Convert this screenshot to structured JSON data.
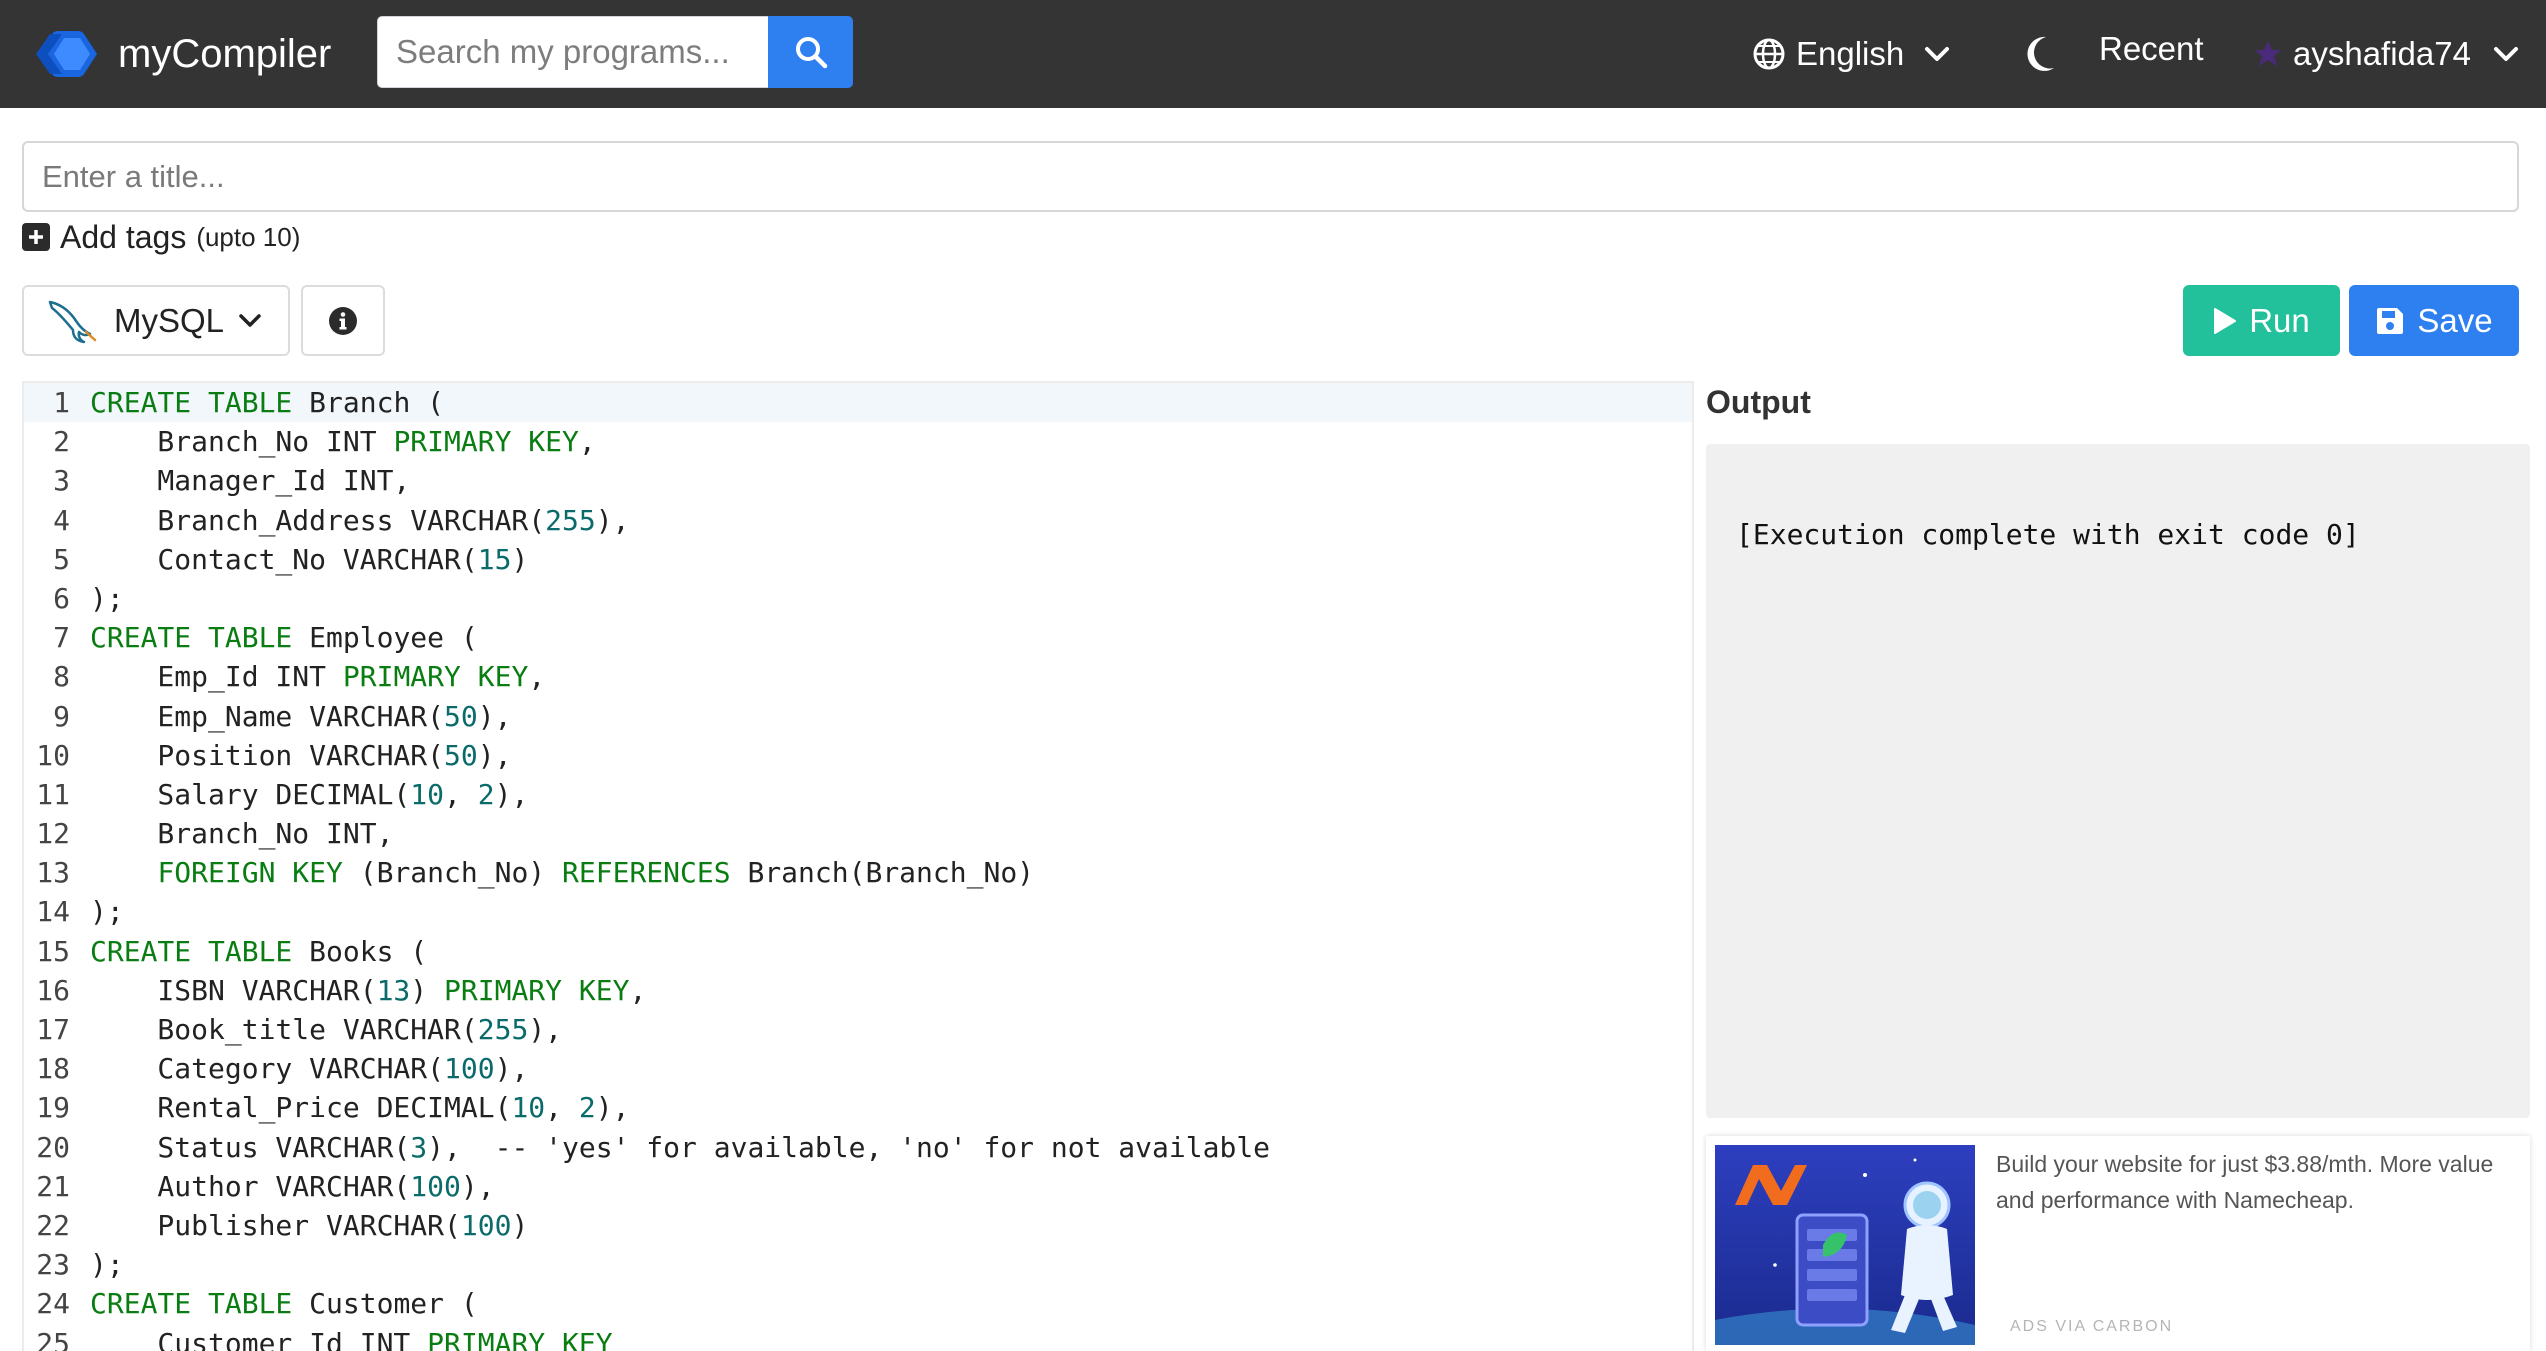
{
  "navbar": {
    "brand": "myCompiler",
    "search_placeholder": "Search my programs...",
    "language_label": "English",
    "recent_label": "Recent",
    "username": "ayshafida74"
  },
  "title_placeholder": "Enter a title...",
  "tags": {
    "label": "Add tags",
    "hint": "(upto 10)"
  },
  "toolbar": {
    "language": "MySQL",
    "run_label": "Run",
    "save_label": "Save"
  },
  "editor": {
    "lines": [
      [
        {
          "t": "CREATE TABLE",
          "c": "kw"
        },
        {
          "t": " Branch ("
        }
      ],
      [
        {
          "t": "    Branch_No INT "
        },
        {
          "t": "PRIMARY KEY",
          "c": "kw"
        },
        {
          "t": ","
        }
      ],
      [
        {
          "t": "    Manager_Id INT,"
        }
      ],
      [
        {
          "t": "    Branch_Address VARCHAR("
        },
        {
          "t": "255",
          "c": "num"
        },
        {
          "t": "),"
        }
      ],
      [
        {
          "t": "    Contact_No VARCHAR("
        },
        {
          "t": "15",
          "c": "num"
        },
        {
          "t": ")"
        }
      ],
      [
        {
          "t": ");"
        }
      ],
      [
        {
          "t": "CREATE TABLE",
          "c": "kw"
        },
        {
          "t": " Employee ("
        }
      ],
      [
        {
          "t": "    Emp_Id INT "
        },
        {
          "t": "PRIMARY KEY",
          "c": "kw"
        },
        {
          "t": ","
        }
      ],
      [
        {
          "t": "    Emp_Name VARCHAR("
        },
        {
          "t": "50",
          "c": "num"
        },
        {
          "t": "),"
        }
      ],
      [
        {
          "t": "    Position VARCHAR("
        },
        {
          "t": "50",
          "c": "num"
        },
        {
          "t": "),"
        }
      ],
      [
        {
          "t": "    Salary DECIMAL("
        },
        {
          "t": "10",
          "c": "num"
        },
        {
          "t": ", "
        },
        {
          "t": "2",
          "c": "num"
        },
        {
          "t": "),"
        }
      ],
      [
        {
          "t": "    Branch_No INT,"
        }
      ],
      [
        {
          "t": "    "
        },
        {
          "t": "FOREIGN KEY",
          "c": "kw"
        },
        {
          "t": " (Branch_No) "
        },
        {
          "t": "REFERENCES",
          "c": "kw"
        },
        {
          "t": " Branch(Branch_No)"
        }
      ],
      [
        {
          "t": ");"
        }
      ],
      [
        {
          "t": "CREATE TABLE",
          "c": "kw"
        },
        {
          "t": " Books ("
        }
      ],
      [
        {
          "t": "    ISBN VARCHAR("
        },
        {
          "t": "13",
          "c": "num"
        },
        {
          "t": ") "
        },
        {
          "t": "PRIMARY KEY",
          "c": "kw"
        },
        {
          "t": ","
        }
      ],
      [
        {
          "t": "    Book_title VARCHAR("
        },
        {
          "t": "255",
          "c": "num"
        },
        {
          "t": "),"
        }
      ],
      [
        {
          "t": "    Category VARCHAR("
        },
        {
          "t": "100",
          "c": "num"
        },
        {
          "t": "),"
        }
      ],
      [
        {
          "t": "    Rental_Price DECIMAL("
        },
        {
          "t": "10",
          "c": "num"
        },
        {
          "t": ", "
        },
        {
          "t": "2",
          "c": "num"
        },
        {
          "t": "),"
        }
      ],
      [
        {
          "t": "    Status VARCHAR("
        },
        {
          "t": "3",
          "c": "num"
        },
        {
          "t": "),  -- 'yes' for available, 'no' for not available"
        }
      ],
      [
        {
          "t": "    Author VARCHAR("
        },
        {
          "t": "100",
          "c": "num"
        },
        {
          "t": "),"
        }
      ],
      [
        {
          "t": "    Publisher VARCHAR("
        },
        {
          "t": "100",
          "c": "num"
        },
        {
          "t": ")"
        }
      ],
      [
        {
          "t": ");"
        }
      ],
      [
        {
          "t": "CREATE TABLE",
          "c": "kw"
        },
        {
          "t": " Customer ("
        }
      ],
      [
        {
          "t": "    Customer_Id INT "
        },
        {
          "t": "PRIMARY KEY",
          "c": "kw"
        }
      ]
    ]
  },
  "output": {
    "heading": "Output",
    "text": "[Execution complete with exit code 0]"
  },
  "ad": {
    "text": "Build your website for just $3.88/mth. More value and performance with Namecheap.",
    "label": "ADS VIA CARBON"
  },
  "colors": {
    "navbar_bg": "#343434",
    "primary": "#2e7ff0",
    "run": "#22c09b",
    "keyword": "#0a7d12",
    "number": "#0b6b6b"
  },
  "icons": [
    "brand-logo-icon",
    "search-icon",
    "globe-icon",
    "chevron-down-icon",
    "moon-icon",
    "user-avatar-icon",
    "plus-square-icon",
    "mysql-dolphin-icon",
    "info-circle-icon",
    "play-icon",
    "floppy-disk-icon"
  ]
}
